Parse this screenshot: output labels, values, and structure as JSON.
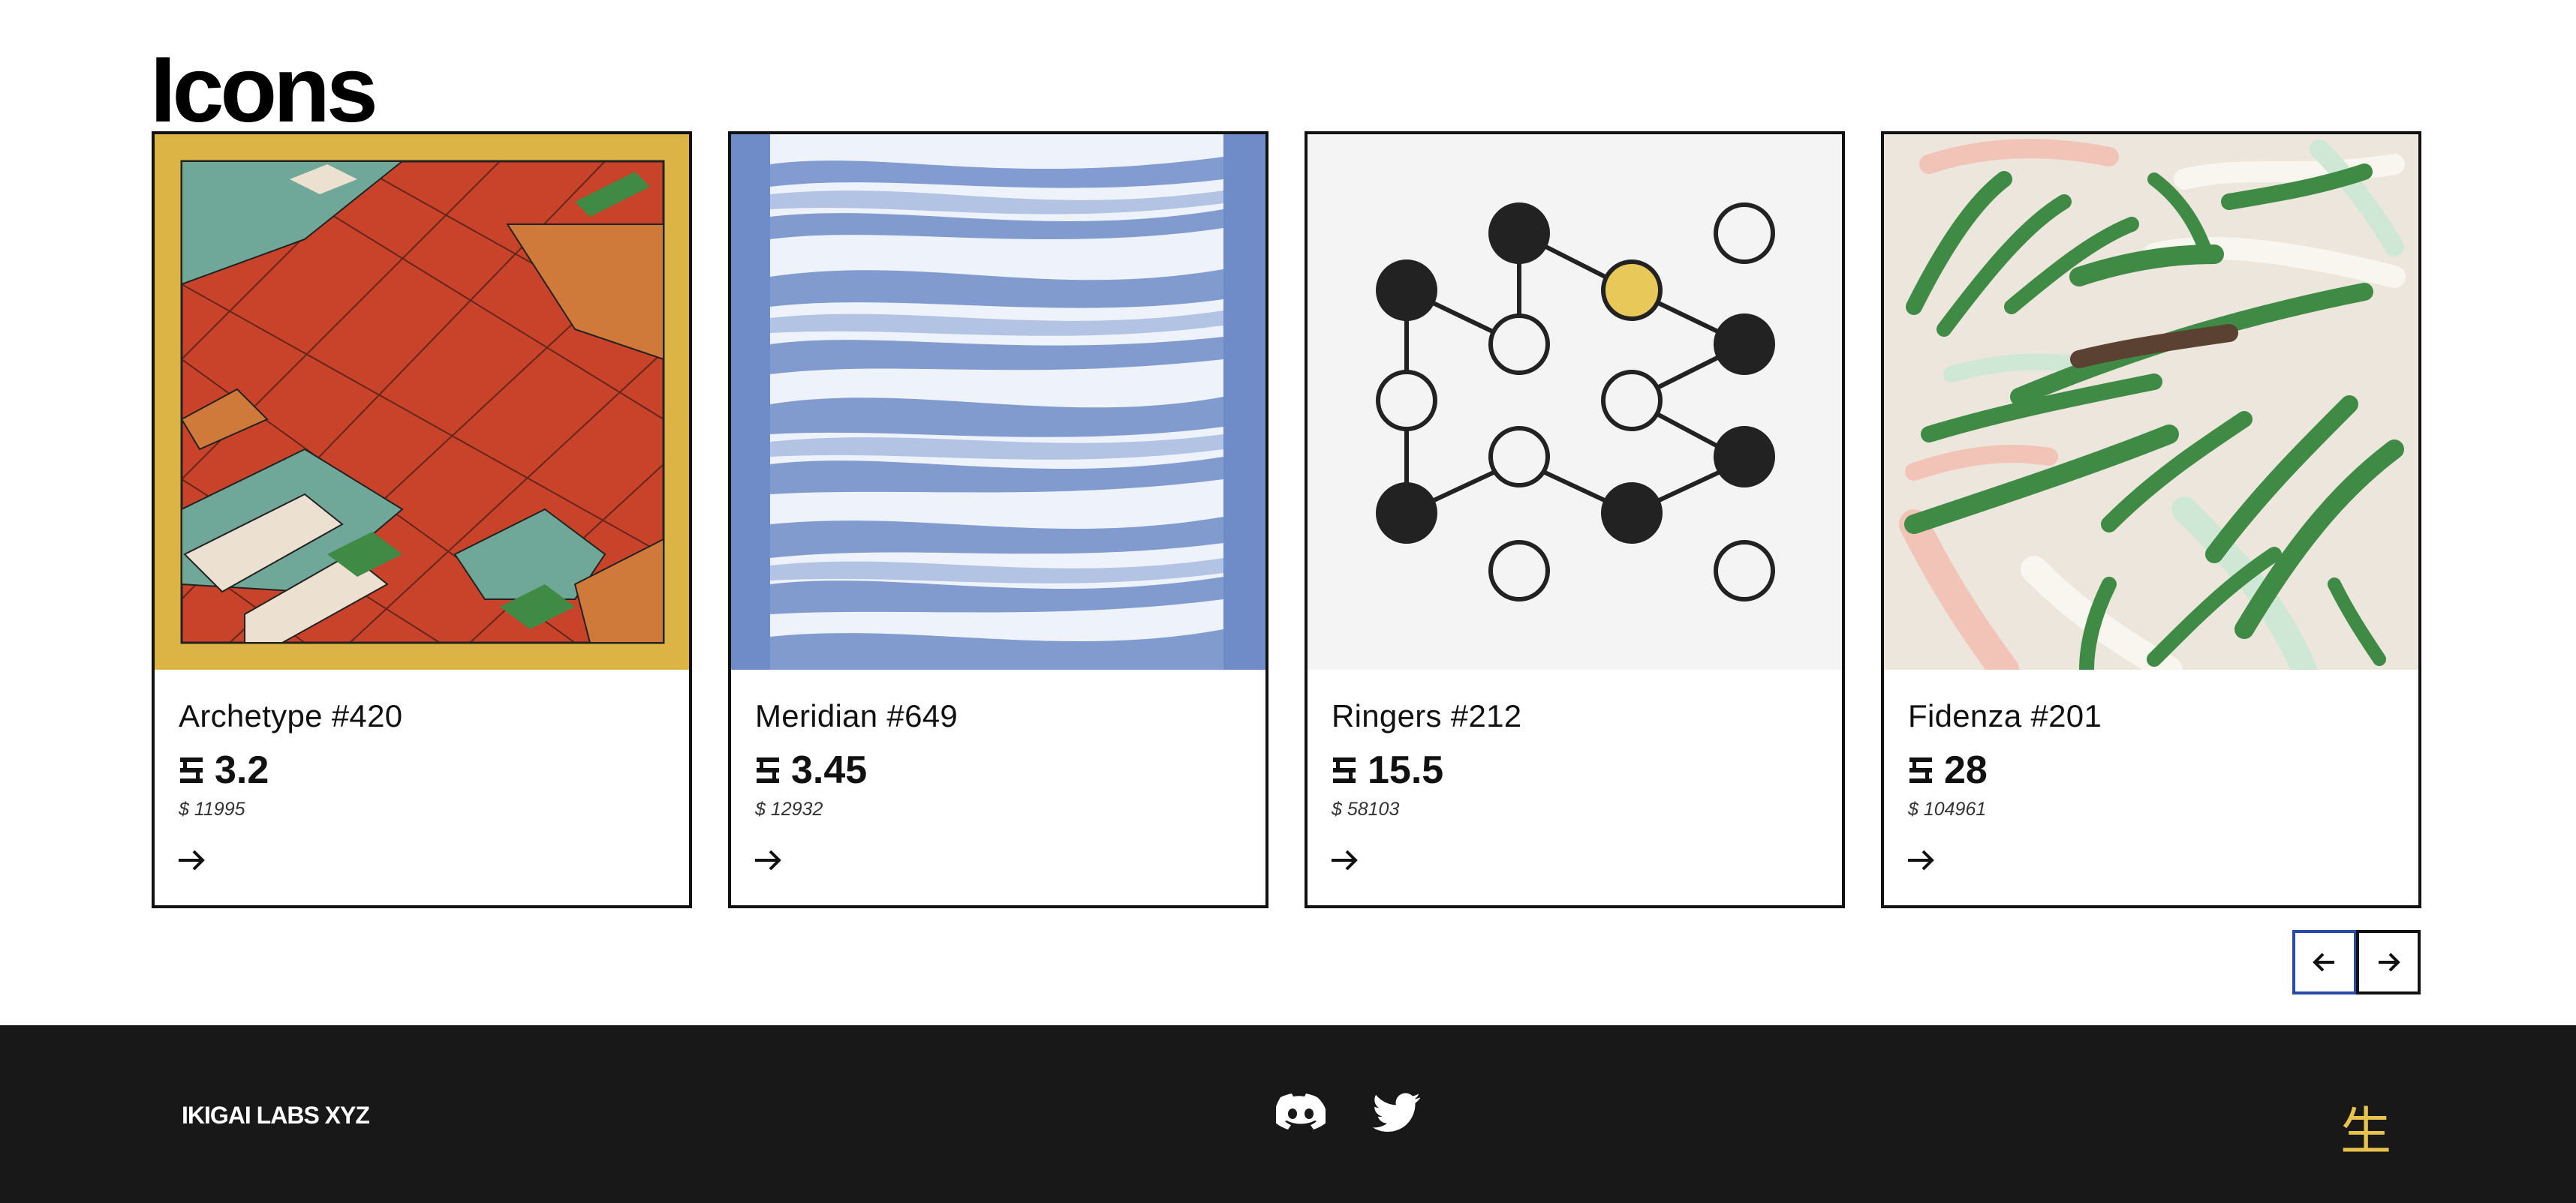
{
  "section": {
    "title": "Icons"
  },
  "cards": [
    {
      "name": "Archetype #420",
      "price": "3.2",
      "usd": "$ 11995",
      "art": "archetype-artwork"
    },
    {
      "name": "Meridian #649",
      "price": "3.45",
      "usd": "$ 12932",
      "art": "meridian-artwork"
    },
    {
      "name": "Ringers #212",
      "price": "15.5",
      "usd": "$ 58103",
      "art": "ringers-artwork"
    },
    {
      "name": "Fidenza #201",
      "price": "28",
      "usd": "$ 104961",
      "art": "fidenza-artwork"
    }
  ],
  "carousel": {
    "prev_icon": "arrow-left-icon",
    "next_icon": "arrow-right-icon"
  },
  "footer": {
    "brand": "IKIGAI LABS XYZ",
    "social": [
      "discord-icon",
      "twitter-icon"
    ],
    "kanji": "生"
  },
  "colors": {
    "footer_bg": "#181818",
    "kanji": "#e8c34c",
    "archetype_frame": "#dcb445",
    "meridian_blue": "#6f8cc8",
    "ringers_bg": "#f4f4f4",
    "ringers_yellow": "#e9c85a",
    "fidenza_bg": "#ece6dc",
    "fidenza_green": "#3f8a45",
    "prev_button_border": "#2a4aa8"
  }
}
